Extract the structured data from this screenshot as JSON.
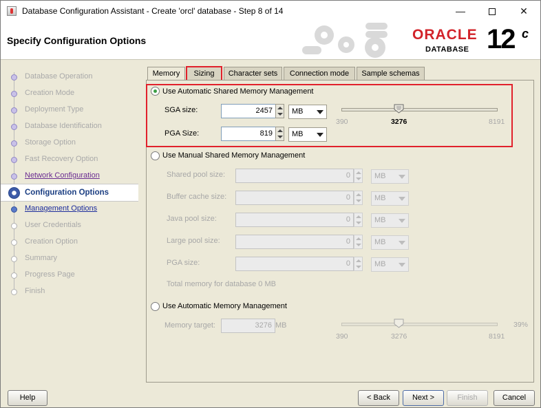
{
  "window": {
    "title": "Database Configuration Assistant - Create 'orcl' database - Step 8 of 14",
    "controls": {
      "minimize": "—",
      "close": "✕"
    }
  },
  "header": {
    "title": "Specify Configuration Options",
    "brand": {
      "oracle": "ORACLE",
      "database": "DATABASE",
      "version": "12",
      "version_suffix": "c",
      "oracle_color": "#d2232a"
    }
  },
  "steps": [
    {
      "label": "Database Operation",
      "state": "done"
    },
    {
      "label": "Creation Mode",
      "state": "done"
    },
    {
      "label": "Deployment Type",
      "state": "done"
    },
    {
      "label": "Database Identification",
      "state": "done"
    },
    {
      "label": "Storage Option",
      "state": "done"
    },
    {
      "label": "Fast Recovery Option",
      "state": "done"
    },
    {
      "label": "Network Configuration",
      "state": "link"
    },
    {
      "label": "Configuration Options",
      "state": "active"
    },
    {
      "label": "Management Options",
      "state": "next"
    },
    {
      "label": "User Credentials",
      "state": "pending"
    },
    {
      "label": "Creation Option",
      "state": "pending"
    },
    {
      "label": "Summary",
      "state": "pending"
    },
    {
      "label": "Progress Page",
      "state": "pending"
    },
    {
      "label": "Finish",
      "state": "pending"
    }
  ],
  "tabs": [
    {
      "label": "Memory",
      "selected": true
    },
    {
      "label": "Sizing",
      "highlighted": true
    },
    {
      "label": "Character sets"
    },
    {
      "label": "Connection mode"
    },
    {
      "label": "Sample schemas"
    }
  ],
  "asmm": {
    "label": "Use Automatic Shared Memory Management",
    "checked": true,
    "sga_label": "SGA size:",
    "sga_value": "2457",
    "sga_unit": "MB",
    "pga_label": "PGA Size:",
    "pga_value": "819",
    "pga_unit": "MB",
    "slider": {
      "min": "390",
      "max": "8191",
      "current": "3276",
      "value": 3276,
      "range": [
        390,
        8191
      ]
    }
  },
  "manual": {
    "label": "Use Manual Shared Memory Management",
    "fields": [
      {
        "label": "Shared pool size:",
        "value": "0",
        "unit": "MB"
      },
      {
        "label": "Buffer cache size:",
        "value": "0",
        "unit": "MB"
      },
      {
        "label": "Java pool size:",
        "value": "0",
        "unit": "MB"
      },
      {
        "label": "Large pool size:",
        "value": "0",
        "unit": "MB"
      },
      {
        "label": "PGA size:",
        "value": "0",
        "unit": "MB"
      }
    ],
    "total": "Total memory for database 0 MB"
  },
  "amm": {
    "label": "Use Automatic Memory Management",
    "target_label": "Memory target:",
    "target_value": "3276",
    "target_unit": "MB",
    "slider": {
      "min": "390",
      "max": "8191",
      "current": "3276",
      "value": 3276,
      "range": [
        390,
        8191
      ]
    },
    "percent": "39%"
  },
  "buttons": {
    "help": "Help",
    "back": "< Back",
    "next": "Next >",
    "finish": "Finish",
    "cancel": "Cancel"
  }
}
